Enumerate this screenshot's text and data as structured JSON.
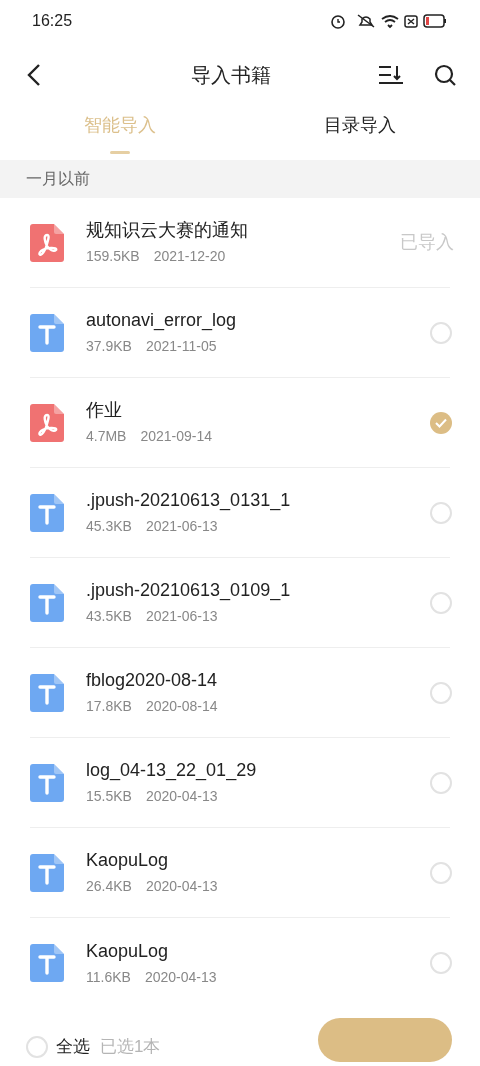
{
  "status_bar": {
    "time": "16:25"
  },
  "header": {
    "title": "导入书籍"
  },
  "tabs": [
    {
      "label": "智能导入",
      "selected": true
    },
    {
      "label": "目录导入",
      "selected": false
    }
  ],
  "section": {
    "label": "一月以前"
  },
  "files": [
    {
      "kind": "pdf",
      "title": "规知识云大赛的通知",
      "size": "159.5KB",
      "date": "2021-12-20",
      "badge": "已导入"
    },
    {
      "kind": "txt",
      "title": "autonavi_error_log",
      "size": "37.9KB",
      "date": "2021-11-05",
      "selected": false
    },
    {
      "kind": "pdf",
      "title": "作业",
      "size": "4.7MB",
      "date": "2021-09-14",
      "selected": true
    },
    {
      "kind": "txt",
      "title": ".jpush-20210613_0131_1",
      "size": "45.3KB",
      "date": "2021-06-13",
      "selected": false
    },
    {
      "kind": "txt",
      "title": ".jpush-20210613_0109_1",
      "size": "43.5KB",
      "date": "2021-06-13",
      "selected": false
    },
    {
      "kind": "txt",
      "title": "fblog2020-08-14",
      "size": "17.8KB",
      "date": "2020-08-14",
      "selected": false
    },
    {
      "kind": "txt",
      "title": "log_04-13_22_01_29",
      "size": "15.5KB",
      "date": "2020-04-13",
      "selected": false
    },
    {
      "kind": "txt",
      "title": "KaopuLog",
      "size": "26.4KB",
      "date": "2020-04-13",
      "selected": false
    },
    {
      "kind": "txt",
      "title": "KaopuLog",
      "size": "11.6KB",
      "date": "2020-04-13",
      "selected": false
    }
  ],
  "footer": {
    "select_all": {
      "label": "全选",
      "checked": false
    },
    "count": "已选1本"
  }
}
